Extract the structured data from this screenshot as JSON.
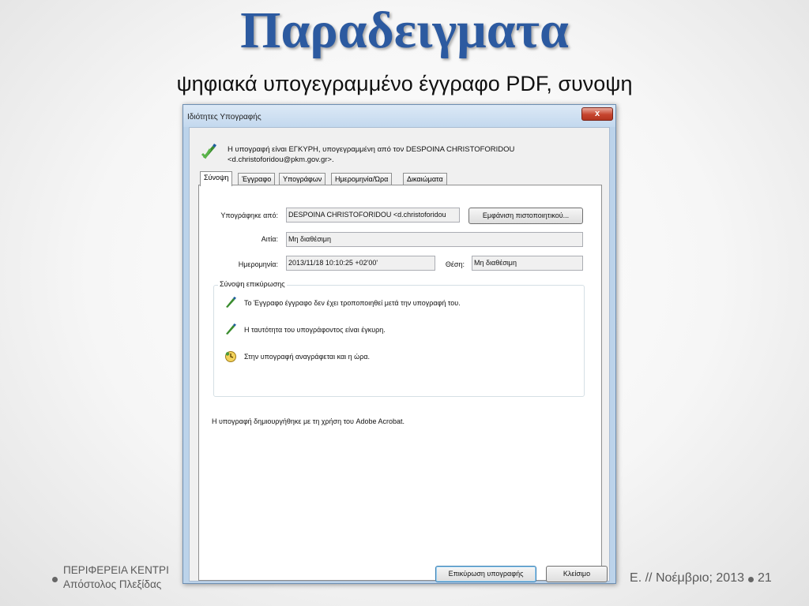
{
  "slide": {
    "title": "Παραδειγματα",
    "subtitle": "ψηφιακά υπογεγραμμένο έγγραφο PDF, συνοψη",
    "footer_left_line1": "ΠΕΡΙΦΕΡΕΙΑ ΚΕΝΤΡΙ",
    "footer_left_line2": "Απόστολος Πλεξίδας",
    "footer_right": "Ε. // Νοέμβριο; 2013",
    "page_number": "21"
  },
  "dialog": {
    "title": "Ιδιότητες Υπογραφής",
    "close_label": "x",
    "status_line1": "Η υπογραφή είναι ΕΓΚΥΡΗ, υπογεγραμμένη από τον DESPOINA CHRISTOFORIDOU",
    "status_line2": "<d.christoforidou@pkm.gov.gr>.",
    "tabs": [
      {
        "label": "Σύνοψη"
      },
      {
        "label": "Έγγραφο"
      },
      {
        "label": "Υπογράφων"
      },
      {
        "label": "Ημερομηνία/Ώρα"
      },
      {
        "label": "Δικαιώματα"
      }
    ],
    "summary": {
      "signed_by_label": "Υπογράφηκε από:",
      "signed_by_value": "DESPOINA CHRISTOFORIDOU <d.christoforidou",
      "show_cert_button": "Εμφάνιση πιστοποιητικού...",
      "reason_label": "Αιτία:",
      "reason_value": "Μη διαθέσιμη",
      "date_label": "Ημερομηνία:",
      "date_value": "2013/11/18 10:10:25 +02'00'",
      "location_label": "Θέση:",
      "location_value": "Μη διαθέσιμη",
      "group_title": "Σύνοψη επικύρωσης",
      "items": [
        {
          "text": "Το Έγγραφο έγγραφο δεν έχει τροποποιηθεί μετά την υπογραφή του."
        },
        {
          "text": "Η ταυτότητα του υπογράφοντος είναι έγκυρη."
        },
        {
          "text": "Στην υπογραφή αναγράφεται και η ώρα."
        }
      ],
      "created_with": "Η υπογραφή δημιουργήθηκε με τη χρήση του Adobe Acrobat."
    },
    "validate_button": "Επικύρωση υπογραφής",
    "close_button": "Κλείσιμο"
  },
  "colors": {
    "title_blue": "#2c5aa0",
    "dialog_frame": "#bcd3ea",
    "close_red": "#c6442e"
  }
}
